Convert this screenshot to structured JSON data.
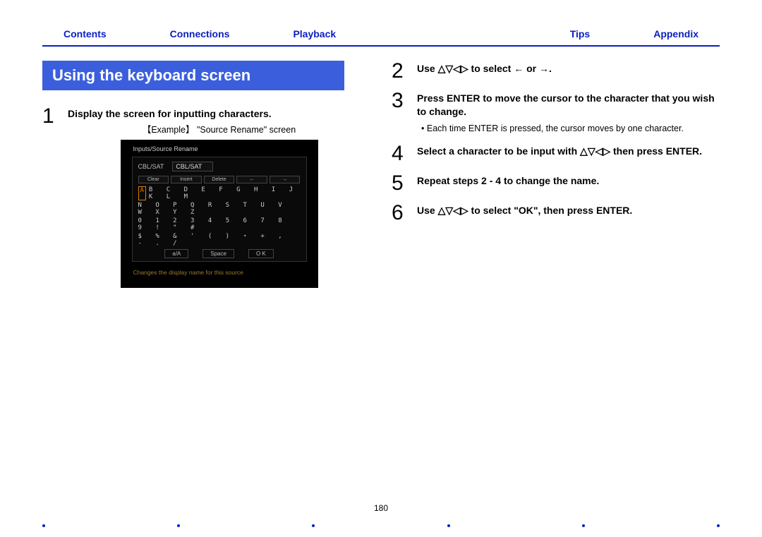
{
  "nav": {
    "contents": "Contents",
    "connections": "Connections",
    "playback": "Playback",
    "tips": "Tips",
    "appendix": "Appendix"
  },
  "header": "Using the keyboard screen",
  "left": {
    "step1_num": "1",
    "step1_text": "Display the screen for inputting characters.",
    "example_label": "【Example】 \"Source Rename\" screen",
    "shot": {
      "title": "Inputs/Source Rename",
      "field_label": "CBL/SAT",
      "field_value": "CBL/SAT",
      "btns": [
        "Clear",
        "Insert",
        "Delete",
        "←",
        "→"
      ],
      "row1_first": "A",
      "row1_rest": "B C D E F G H I J K L M",
      "row2": "N O P Q R S T U V W X Y Z",
      "row3": "0 1 2 3 4 5 6 7 8 9 ! \" #",
      "row4": "$ % & ' ( ) ⋆ + , - . /",
      "space_row": [
        "a/A",
        "Space",
        "O K"
      ],
      "footer": "Changes the display name for this source"
    }
  },
  "right": {
    "s2_num": "2",
    "s2_text": "Use △▽◁▷ to select ← or →.",
    "s3_num": "3",
    "s3_text": "Press ENTER to move the cursor to the character that you wish to change.",
    "s3_bullet": "Each time ENTER is pressed, the cursor moves by one character.",
    "s4_num": "4",
    "s4_text": "Select a character to be input with △▽◁▷ then press ENTER.",
    "s5_num": "5",
    "s5_text": "Repeat steps 2 - 4 to change the name.",
    "s6_num": "6",
    "s6_text": "Use △▽◁▷ to select \"OK\", then press ENTER."
  },
  "page_number": "180"
}
